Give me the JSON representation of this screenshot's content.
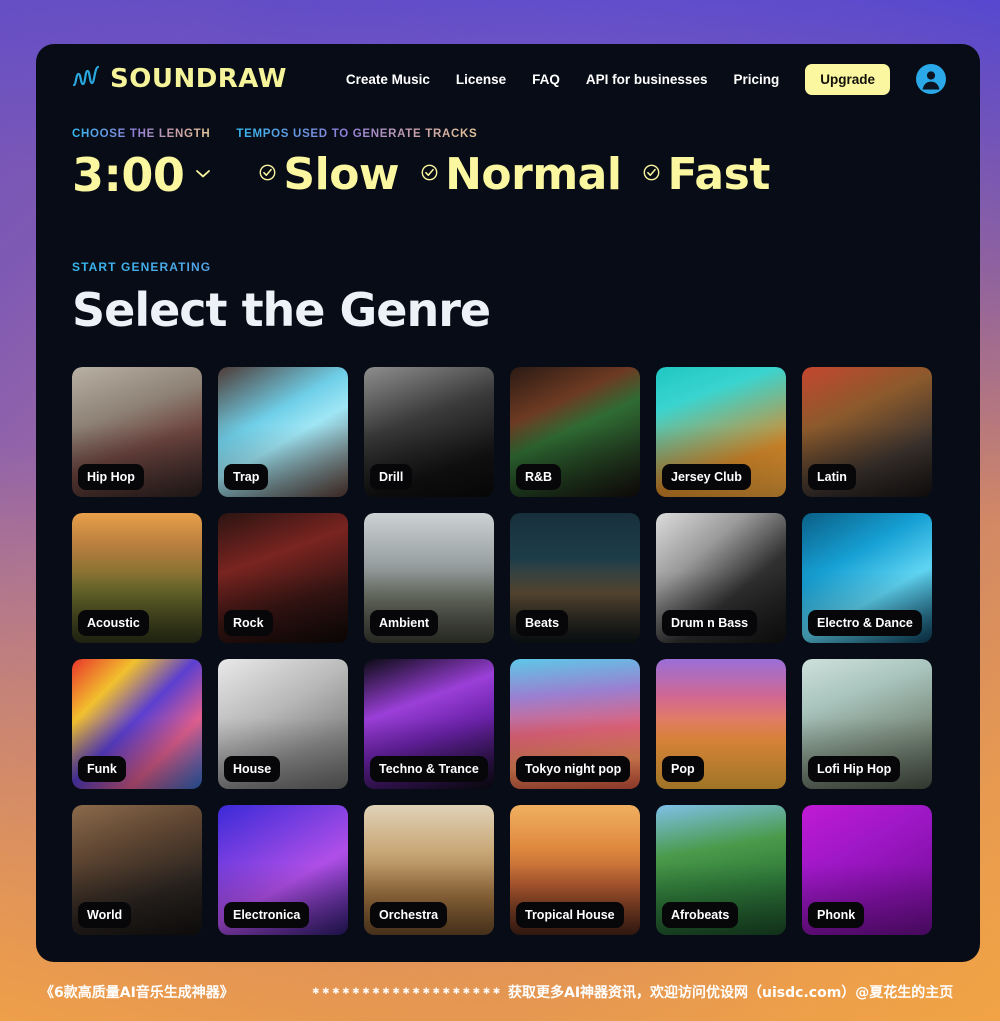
{
  "brand": {
    "logo_text": "SOUNDRAW",
    "logo_mark_icon": "waveform-icon",
    "logo_text_color": "#f6f49a",
    "logo_mark_color": "#29a8e0"
  },
  "header": {
    "nav": [
      {
        "label": "Create Music",
        "name": "nav-create-music"
      },
      {
        "label": "License",
        "name": "nav-license"
      },
      {
        "label": "FAQ",
        "name": "nav-faq"
      },
      {
        "label": "API for businesses",
        "name": "nav-api-for-businesses"
      },
      {
        "label": "Pricing",
        "name": "nav-pricing"
      }
    ],
    "upgrade_label": "Upgrade",
    "upgrade_bg": "#fbf6a0",
    "avatar_icon": "user-avatar-icon",
    "avatar_color": "#2aa8e8"
  },
  "controls": {
    "length_label": "CHOOSE THE LENGTH",
    "tempo_label": "TEMPOS USED TO GENERATE TRACKS",
    "length_value": "3:00",
    "length_chevron_icon": "chevron-down-icon",
    "tempos": [
      {
        "label": "Slow",
        "icon": "check-circle-icon",
        "selected": true
      },
      {
        "label": "Normal",
        "icon": "check-circle-icon",
        "selected": true
      },
      {
        "label": "Fast",
        "icon": "check-circle-icon",
        "selected": true
      }
    ],
    "accent_yellow": "#fbf6a0"
  },
  "genre_section": {
    "kicker": "START GENERATING",
    "title": "Select the Genre",
    "cards": [
      {
        "label": "Hip Hop",
        "art": "linear-gradient(160deg,#b9b0a4 0%,#8e8276 35%,#6d4540 60%,#2c2220 100%)"
      },
      {
        "label": "Trap",
        "art": "linear-gradient(150deg,#4e3b36 0%,#6fcfe8 38%,#9fe6f5 55%,#5a3c34 100%)"
      },
      {
        "label": "Drill",
        "art": "linear-gradient(160deg,#8e8e8e 0%,#3a3a3a 40%,#121212 75%,#0a0a0a 100%)"
      },
      {
        "label": "R&B",
        "art": "linear-gradient(155deg,#2a1a14 0%,#6d3a22 30%,#2f6b33 48%,#150d0c 100%)"
      },
      {
        "label": "Jersey Club",
        "art": "linear-gradient(160deg,#1fc7c2 0%,#3ad4cf 25%,#d98b2a 70%,#f0a63c 100%)"
      },
      {
        "label": "Latin",
        "art": "linear-gradient(155deg,#c4462e 0%,#8b5a2c 35%,#3b332f 70%,#171313 100%)"
      },
      {
        "label": "Acoustic",
        "art": "linear-gradient(180deg,#e8a04a 0%,#b87e3e 25%,#6b6b2c 60%,#2e3318 100%)"
      },
      {
        "label": "Rock",
        "art": "linear-gradient(160deg,#2b1412 0%,#7a2420 35%,#3a1614 65%,#0e0807 100%)"
      },
      {
        "label": "Ambient",
        "art": "linear-gradient(180deg,#cdd2d4 0%,#9aa1a3 38%,#6a6f63 66%,#3a3c33 100%)"
      },
      {
        "label": "Beats",
        "art": "linear-gradient(180deg,#18303c 0%,#1d3c49 35%,#5a4a33 62%,#0c1418 100%)"
      },
      {
        "label": "Drum n Bass",
        "art": "linear-gradient(140deg,#dcdcdc 0%,#9a9a9a 32%,#303030 62%,#111111 100%)"
      },
      {
        "label": "Electro & Dance",
        "art": "linear-gradient(150deg,#0a5f86 0%,#16a0d4 35%,#5fd4f2 62%,#0b3d58 100%)"
      },
      {
        "label": "Funk",
        "art": "linear-gradient(135deg,#e8352a 0%,#f2c12e 25%,#5b3fd0 48%,#e05f8f 72%,#2f6fd0 100%)"
      },
      {
        "label": "House",
        "art": "linear-gradient(150deg,#e9e9e9 0%,#b9b9b9 40%,#8a8a8a 70%,#6a6a6a 100%)"
      },
      {
        "label": "Techno & Trance",
        "art": "linear-gradient(160deg,#0b0b14 0%,#9b3fd8 35%,#6a22a8 58%,#0a0a12 100%)"
      },
      {
        "label": "Tokyo night pop",
        "art": "linear-gradient(175deg,#5ec8e8 0%,#9a7fd0 28%,#e0637a 55%,#f08a5a 78%,#d4553f 100%)"
      },
      {
        "label": "Pop",
        "art": "linear-gradient(180deg,#9a6fd8 0%,#d2688f 30%,#f0913f 62%,#f4b13a 100%)"
      },
      {
        "label": "Lofi Hip Hop",
        "art": "linear-gradient(160deg,#cfe0dc 0%,#a8c4bd 30%,#7e8f80 62%,#4a5448 100%)"
      },
      {
        "label": "World",
        "art": "linear-gradient(160deg,#8a6a4a 0%,#5a4230 35%,#2a2420 68%,#141210 100%)"
      },
      {
        "label": "Electronica",
        "art": "linear-gradient(150deg,#3a2ad8 0%,#7a3fe0 32%,#b04fe8 58%,#2a1a6a 100%)"
      },
      {
        "label": "Orchestra",
        "art": "linear-gradient(180deg,#e0d2b8 0%,#c9a878 35%,#9a6f3f 70%,#6a4a28 100%)"
      },
      {
        "label": "Tropical House",
        "art": "linear-gradient(180deg,#f0b060 0%,#e08a40 32%,#b25a30 62%,#4a2418 100%)"
      },
      {
        "label": "Afrobeats",
        "art": "linear-gradient(170deg,#7fc0e8 0%,#4a9a4a 35%,#2f7a3a 62%,#1a4a28 100%)"
      },
      {
        "label": "Phonk",
        "art": "linear-gradient(150deg,#c01ad4 0%,#a018c8 35%,#8a12b0 62%,#6a0e8c 100%)"
      }
    ]
  },
  "watermark": {
    "left_text": "《6款高质量AI音乐生成神器》",
    "dots": "✱✱✱✱✱✱✱✱✱✱✱✱✱✱✱✱✱✱✱",
    "right_text": "获取更多AI神器资讯，欢迎访问优设网（uisdc.com）@夏花生的主页"
  }
}
